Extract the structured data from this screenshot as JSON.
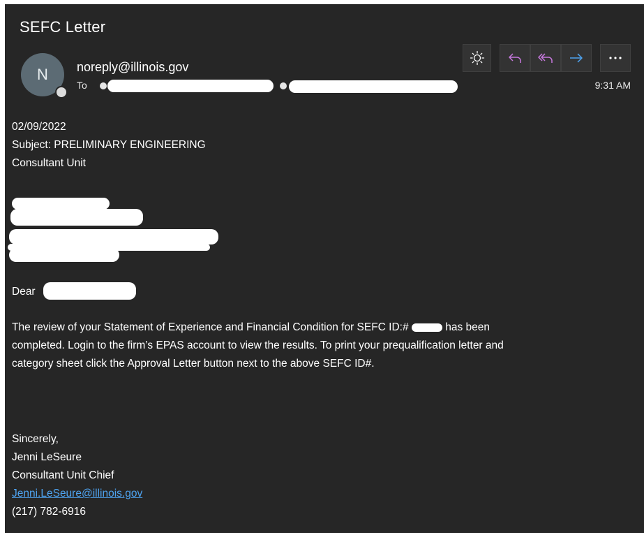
{
  "email": {
    "subject": "SEFC Letter",
    "avatar_initial": "N",
    "sender": "noreply@illinois.gov",
    "to_label": "To",
    "time": "9:31 AM"
  },
  "toolbar": {
    "icons": [
      "sun-icon",
      "reply-icon",
      "reply-all-icon",
      "forward-icon",
      "more-icon"
    ],
    "more_label": "···"
  },
  "body": {
    "date": "02/09/2022",
    "subject_line": "Subject: PRELIMINARY ENGINEERING",
    "unit_line": "Consultant Unit",
    "salutation": "Dear",
    "paragraph_before_id": "The review of your Statement of Experience and Financial Condition for SEFC ID:#",
    "paragraph_after_id_line1": "has been",
    "paragraph_line2": "completed. Login to the firm’s EPAS account to view the results. To print your prequalification letter and",
    "paragraph_line3": "category sheet click the Approval Letter button next to the above SEFC ID#.",
    "closing": "Sincerely,",
    "signature_name": "Jenni LeSeure",
    "signature_title": "Consultant Unit Chief",
    "signature_email": "Jenni.LeSeure@illinois.gov",
    "signature_phone": "(217) 782-6916"
  },
  "colors": {
    "background": "#262626",
    "link": "#4ea3f0",
    "reply_accent": "#c678dd",
    "forward_accent": "#4ea3f0"
  }
}
